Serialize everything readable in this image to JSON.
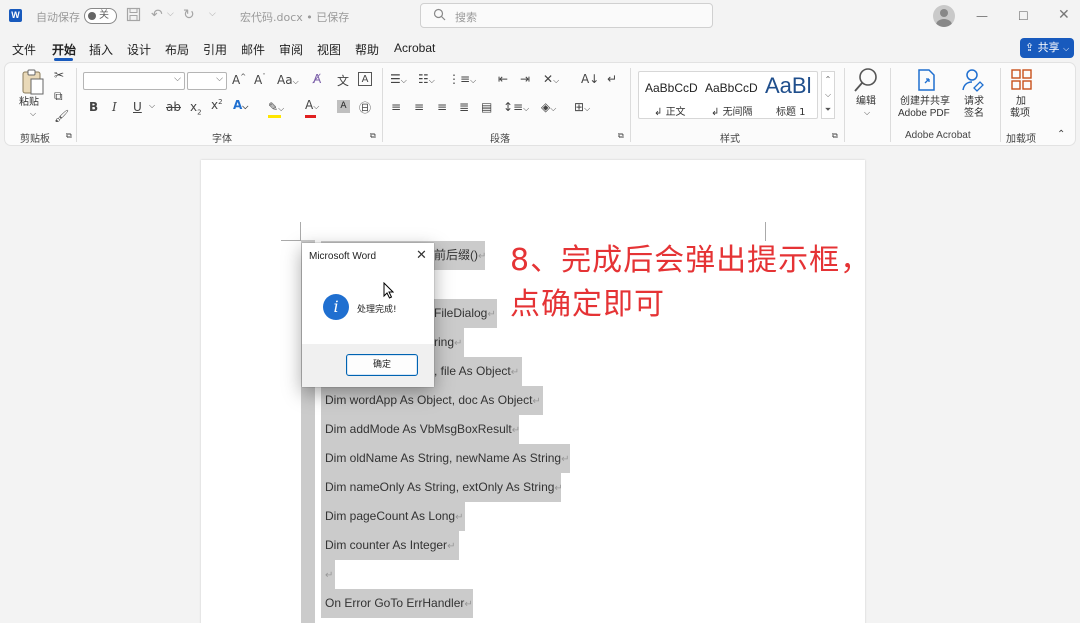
{
  "titlebar": {
    "autosave_label": "自动保存",
    "autosave_state": "关",
    "doc_title": "宏代码.docx • 已保存",
    "search_placeholder": "搜索"
  },
  "menu": {
    "tabs": [
      "文件",
      "开始",
      "插入",
      "设计",
      "布局",
      "引用",
      "邮件",
      "审阅",
      "视图",
      "帮助",
      "Acrobat"
    ],
    "active": "开始",
    "share_label": "共享"
  },
  "ribbon": {
    "paste_label": "粘贴",
    "groups": {
      "clipboard": "剪贴板",
      "font": "字体",
      "paragraph": "段落",
      "styles": "样式",
      "adobe": "Adobe Acrobat",
      "addins": "加载项"
    },
    "styles": [
      {
        "preview": "AaBbCcD",
        "name": "正文"
      },
      {
        "preview": "AaBbCcD",
        "name": "无间隔"
      },
      {
        "preview": "AaBl",
        "name": "标题 1"
      }
    ],
    "edit_label": "编辑",
    "create_pdf_l1": "创建并共享",
    "create_pdf_l2": "Adobe PDF",
    "request_sign_l1": "请求",
    "request_sign_l2": "签名",
    "addins_l1": "加",
    "addins_l2": "载项"
  },
  "document": {
    "lines": [
      "前后缀()",
      "FileDialog",
      "ring",
      ", file As Object",
      "Dim wordApp As Object, doc As Object",
      "Dim addMode As VbMsgBoxResult",
      "Dim oldName As String, newName As String",
      "Dim nameOnly As String, extOnly As String",
      "Dim pageCount As Long",
      "Dim counter As Integer",
      "",
      "On Error GoTo ErrHandler"
    ]
  },
  "annotation": {
    "line1": "8、完成后会弹出提示框，",
    "line2": "点确定即可",
    "color": "#e53335"
  },
  "dialog": {
    "title": "Microsoft Word",
    "message": "处理完成!",
    "ok_label": "确定"
  }
}
